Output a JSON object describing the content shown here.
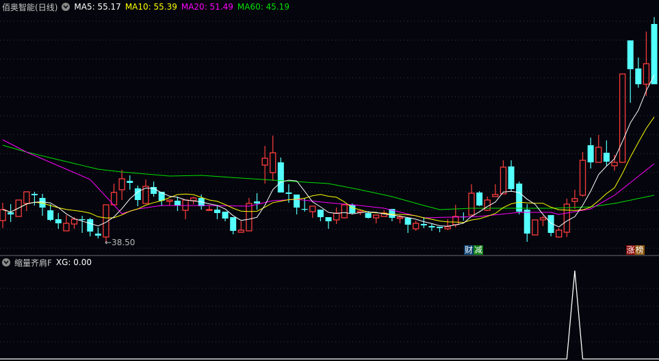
{
  "header": {
    "stock_name": "佰奥智能",
    "period": "(日线)",
    "ma5": {
      "label": "MA5: 55.17",
      "color": "#ffffff"
    },
    "ma10": {
      "label": "MA10: 55.39",
      "color": "#ffff00"
    },
    "ma20": {
      "label": "MA20: 51.49",
      "color": "#ff00ff"
    },
    "ma60": {
      "label": "MA60: 45.19",
      "color": "#00e000"
    }
  },
  "indicator": {
    "name": "缩量齐肩F",
    "value_label": "XG: 0.00"
  },
  "annotations": {
    "low_label": "←38.50",
    "event1": {
      "a": "财",
      "b": "减",
      "bar": 59
    },
    "event2": {
      "a": "涨",
      "b": "榜",
      "bar": 78
    }
  },
  "colors": {
    "up": "#ff3c3c",
    "down": "#54ffff",
    "background": "#05060d"
  },
  "chart_data": {
    "type": "candlestick",
    "price_range": [
      35.5,
      80.9
    ],
    "ohlc": [
      [
        42.22,
        45.34,
        40.9,
        44.14
      ],
      [
        43.66,
        45.1,
        41.98,
        43.3
      ],
      [
        42.94,
        45.82,
        42.94,
        45.82
      ],
      [
        45.22,
        47.26,
        43.9,
        47.26
      ],
      [
        46.9,
        47.26,
        44.86,
        46.66
      ],
      [
        46.18,
        46.9,
        43.06,
        44.5
      ],
      [
        44.02,
        45.1,
        42.1,
        42.34
      ],
      [
        42.46,
        43.54,
        40.78,
        41.74
      ],
      [
        40.42,
        43.18,
        40.42,
        41.74
      ],
      [
        41.62,
        42.82,
        40.78,
        42.46
      ],
      [
        42.46,
        43.06,
        40.06,
        42.34
      ],
      [
        42.46,
        42.7,
        39.46,
        40.3
      ],
      [
        39.94,
        41.02,
        39.1,
        39.58
      ],
      [
        39.34,
        44.98,
        38.5,
        44.98
      ],
      [
        44.98,
        48.7,
        44.98,
        47.14
      ],
      [
        47.62,
        51.1,
        45.82,
        49.54
      ],
      [
        49.18,
        50.14,
        47.62,
        48.82
      ],
      [
        47.86,
        48.34,
        44.74,
        45.82
      ],
      [
        45.22,
        49.42,
        45.22,
        48.22
      ],
      [
        48.1,
        49.06,
        46.42,
        46.9
      ],
      [
        47.26,
        47.26,
        44.74,
        45.7
      ],
      [
        45.58,
        45.82,
        44.86,
        45.82
      ],
      [
        45.7,
        46.42,
        43.9,
        44.86
      ],
      [
        44.02,
        45.82,
        42.46,
        45.82
      ],
      [
        45.7,
        46.42,
        45.1,
        46.18
      ],
      [
        46.18,
        46.78,
        44.14,
        44.74
      ],
      [
        44.02,
        44.86,
        44.02,
        44.14
      ],
      [
        44.14,
        44.86,
        42.46,
        43.54
      ],
      [
        43.78,
        43.78,
        42.1,
        42.58
      ],
      [
        42.82,
        42.82,
        39.82,
        40.42
      ],
      [
        40.18,
        42.1,
        40.18,
        40.54
      ],
      [
        40.42,
        46.18,
        40.42,
        45.22
      ],
      [
        45.58,
        47.02,
        44.14,
        45.22
      ],
      [
        51.94,
        55.3,
        48.7,
        53.14
      ],
      [
        50.62,
        57.1,
        49.18,
        54.1
      ],
      [
        52.42,
        53.26,
        47.14,
        47.14
      ],
      [
        47.14,
        48.58,
        45.34,
        46.9
      ],
      [
        46.78,
        46.78,
        43.3,
        44.5
      ],
      [
        44.26,
        46.18,
        43.78,
        44.14
      ],
      [
        43.78,
        44.74,
        42.7,
        44.74
      ],
      [
        44.14,
        44.14,
        42.1,
        42.82
      ],
      [
        42.82,
        42.82,
        40.78,
        42.1
      ],
      [
        42.34,
        44.5,
        41.62,
        43.54
      ],
      [
        42.7,
        44.98,
        42.7,
        44.98
      ],
      [
        44.98,
        45.22,
        43.3,
        43.54
      ],
      [
        43.66,
        44.02,
        43.18,
        43.9
      ],
      [
        43.54,
        43.9,
        42.58,
        42.7
      ],
      [
        42.7,
        43.18,
        41.74,
        43.18
      ],
      [
        42.94,
        44.02,
        42.94,
        43.54
      ],
      [
        44.26,
        44.26,
        42.1,
        42.7
      ],
      [
        42.58,
        43.18,
        41.74,
        42.82
      ],
      [
        42.7,
        42.7,
        40.06,
        41.5
      ],
      [
        40.78,
        42.22,
        40.42,
        41.74
      ],
      [
        41.62,
        42.82,
        40.9,
        41.38
      ],
      [
        41.26,
        41.62,
        40.42,
        41.02
      ],
      [
        41.14,
        41.14,
        40.18,
        40.9
      ],
      [
        40.78,
        42.46,
        40.54,
        41.14
      ],
      [
        41.5,
        44.98,
        41.02,
        42.94
      ],
      [
        42.94,
        43.66,
        42.22,
        42.82
      ],
      [
        43.18,
        48.58,
        43.18,
        47.02
      ],
      [
        47.14,
        47.38,
        44.74,
        44.86
      ],
      [
        44.02,
        46.42,
        43.9,
        45.82
      ],
      [
        46.42,
        48.58,
        46.42,
        46.78
      ],
      [
        46.9,
        52.78,
        46.9,
        51.58
      ],
      [
        51.7,
        52.78,
        47.38,
        47.74
      ],
      [
        48.7,
        49.06,
        43.3,
        43.78
      ],
      [
        44.14,
        45.1,
        38.5,
        39.94
      ],
      [
        39.7,
        42.34,
        39.7,
        42.34
      ],
      [
        42.34,
        43.06,
        41.26,
        42.7
      ],
      [
        43.18,
        43.18,
        39.46,
        40.06
      ],
      [
        39.34,
        40.9,
        39.22,
        40.54
      ],
      [
        40.18,
        46.06,
        39.34,
        45.1
      ],
      [
        45.58,
        47.62,
        44.26,
        46.06
      ],
      [
        46.66,
        54.22,
        46.42,
        52.78
      ],
      [
        55.42,
        56.74,
        51.34,
        52.42
      ],
      [
        52.42,
        57.22,
        52.42,
        55.06
      ],
      [
        54.1,
        56.26,
        51.82,
        52.54
      ],
      [
        51.82,
        53.74,
        50.98,
        52.42
      ],
      [
        52.42,
        67.9,
        52.42,
        67.9
      ],
      [
        73.78,
        73.78,
        62.86,
        68.74
      ],
      [
        68.86,
        70.78,
        65.5,
        66.1
      ],
      [
        66.1,
        75.34,
        64.06,
        69.7
      ],
      [
        76.66,
        77.86,
        66.1,
        66.1
      ]
    ],
    "ma20_keyframes": [
      [
        0,
        56.38
      ],
      [
        3,
        54.22
      ],
      [
        8,
        51.22
      ],
      [
        11,
        49.42
      ],
      [
        15,
        43.42
      ],
      [
        17,
        44.26
      ],
      [
        20,
        44.86
      ],
      [
        26,
        44.86
      ],
      [
        31,
        44.74
      ],
      [
        34,
        45.7
      ],
      [
        37,
        45.94
      ],
      [
        41,
        45.34
      ],
      [
        45,
        44.86
      ],
      [
        48,
        44.38
      ],
      [
        53,
        42.7
      ],
      [
        60,
        42.94
      ],
      [
        65,
        43.66
      ],
      [
        69,
        43.66
      ],
      [
        70,
        43.3
      ],
      [
        74,
        44.26
      ],
      [
        77,
        46.66
      ],
      [
        82,
        52.18
      ]
    ],
    "ma60_keyframes": [
      [
        0,
        55.42
      ],
      [
        3,
        54.22
      ],
      [
        12,
        51.22
      ],
      [
        15,
        50.74
      ],
      [
        21,
        50.02
      ],
      [
        25,
        50.14
      ],
      [
        30,
        49.66
      ],
      [
        34,
        49.3
      ],
      [
        41,
        48.7
      ],
      [
        45,
        47.62
      ],
      [
        49,
        46.42
      ],
      [
        53,
        44.86
      ],
      [
        55,
        44.14
      ],
      [
        59,
        44.38
      ],
      [
        69,
        44.38
      ],
      [
        74,
        44.62
      ],
      [
        77,
        45.22
      ],
      [
        82,
        46.66
      ]
    ],
    "xg_signal_bars": [
      72
    ],
    "xg_range": [
      0,
      1
    ]
  }
}
